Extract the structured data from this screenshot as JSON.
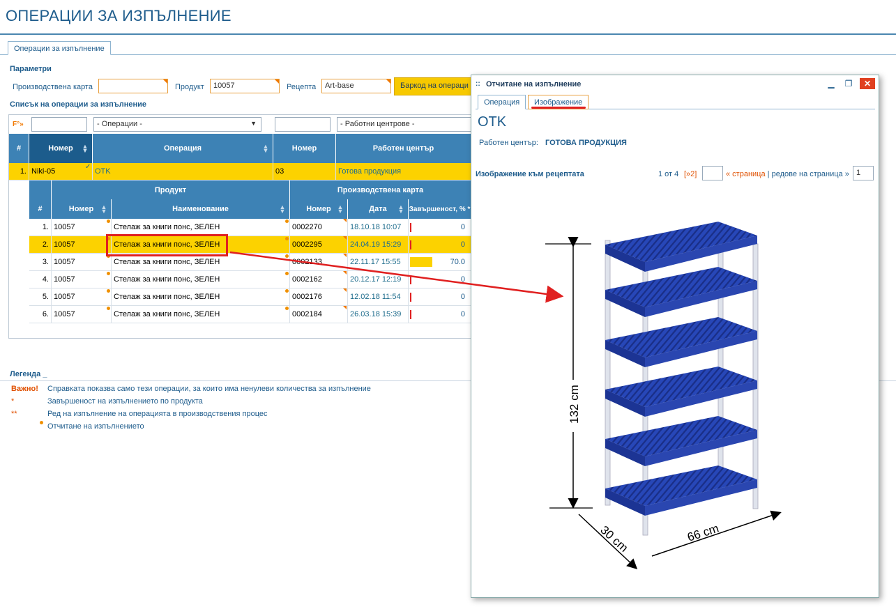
{
  "page": {
    "title": "ОПЕРАЦИИ ЗА ИЗПЪЛНЕНИЕ",
    "tab": "Операции за изпълнение"
  },
  "params": {
    "section": "Параметри",
    "card_label": "Производствена карта",
    "card_value": "",
    "product_label": "Продукт",
    "product_value": "10057",
    "recipe_label": "Рецепта",
    "recipe_value": "Art-base",
    "barcode_button": "Баркод на операци"
  },
  "list": {
    "section": "Списък на операции за изпълнение",
    "filter_icon": "F°»",
    "ops_filter": "- Операции -",
    "wc_filter": "- Работни центрове -",
    "headers": {
      "num": "#",
      "number": "Номер",
      "operation": "Операция",
      "number2": "Номер",
      "workcenter": "Работен център"
    },
    "main_row": {
      "idx": "1.",
      "number": "Niki-05",
      "operation": "OTK",
      "number2": "03",
      "workcenter": "Готова продукция"
    }
  },
  "sub": {
    "group_product": "Продукт",
    "group_card": "Производствена карта",
    "headers": {
      "num": "#",
      "number": "Номер",
      "name": "Наименование",
      "card_number": "Номер",
      "date": "Дата",
      "completion": "Завършеност, % *"
    },
    "rows": [
      {
        "idx": "1.",
        "number": "10057",
        "name": "Стелаж за книги понс, ЗЕЛЕН",
        "card": "0002270",
        "date": "18.10.18 10:07",
        "pct": "0"
      },
      {
        "idx": "2.",
        "number": "10057",
        "name": "Стелаж за книги понс, ЗЕЛЕН",
        "card": "0002295",
        "date": "24.04.19 15:29",
        "pct": "0"
      },
      {
        "idx": "3.",
        "number": "10057",
        "name": "Стелаж за книги понс, ЗЕЛЕН",
        "card": "0002133",
        "date": "22.11.17 15:55",
        "pct": "70.0"
      },
      {
        "idx": "4.",
        "number": "10057",
        "name": "Стелаж за книги понс, ЗЕЛЕН",
        "card": "0002162",
        "date": "20.12.17 12:19",
        "pct": "0"
      },
      {
        "idx": "5.",
        "number": "10057",
        "name": "Стелаж за книги понс, ЗЕЛЕН",
        "card": "0002176",
        "date": "12.02.18 11:54",
        "pct": "0"
      },
      {
        "idx": "6.",
        "number": "10057",
        "name": "Стелаж за книги понс, ЗЕЛЕН",
        "card": "0002184",
        "date": "26.03.18 15:39",
        "pct": "0"
      }
    ],
    "row3_fill": 0.7
  },
  "legend": {
    "title": "Легенда _",
    "items": [
      {
        "mark": "Важно!",
        "text": "Справката показва само тези операции, за които има ненулеви количества за изпълнение"
      },
      {
        "mark": "*",
        "text": "Завършеност на изпълнението по продукта"
      },
      {
        "mark": "**",
        "text": "Ред на изпълнение на операцията в производствения процес"
      },
      {
        "mark": "",
        "text": "Отчитане на изпълнението"
      }
    ]
  },
  "modal": {
    "title": "Отчитане на изпълнение",
    "tab_operation": "Операция",
    "tab_image": "Изображение",
    "heading": "OTK",
    "wc_label": "Работен център:",
    "wc_value": "ГОТОВА ПРОДУКЦИЯ",
    "image_section": "Изображение към рецептата",
    "pager_info": "1 от 4",
    "pager_next": "[»2]",
    "pager_page": "« страница",
    "pager_sep": "|",
    "pager_rows": "редове на страница »",
    "pager_rows_value": "1",
    "dim_height": "132 cm",
    "dim_depth": "30 cm",
    "dim_width": "66 cm"
  },
  "colors": {
    "accent": "#1e5c8c",
    "header": "#3d82b5",
    "selected": "#fcd200",
    "annotation": "#e02020",
    "shelf": "#2747b8"
  }
}
